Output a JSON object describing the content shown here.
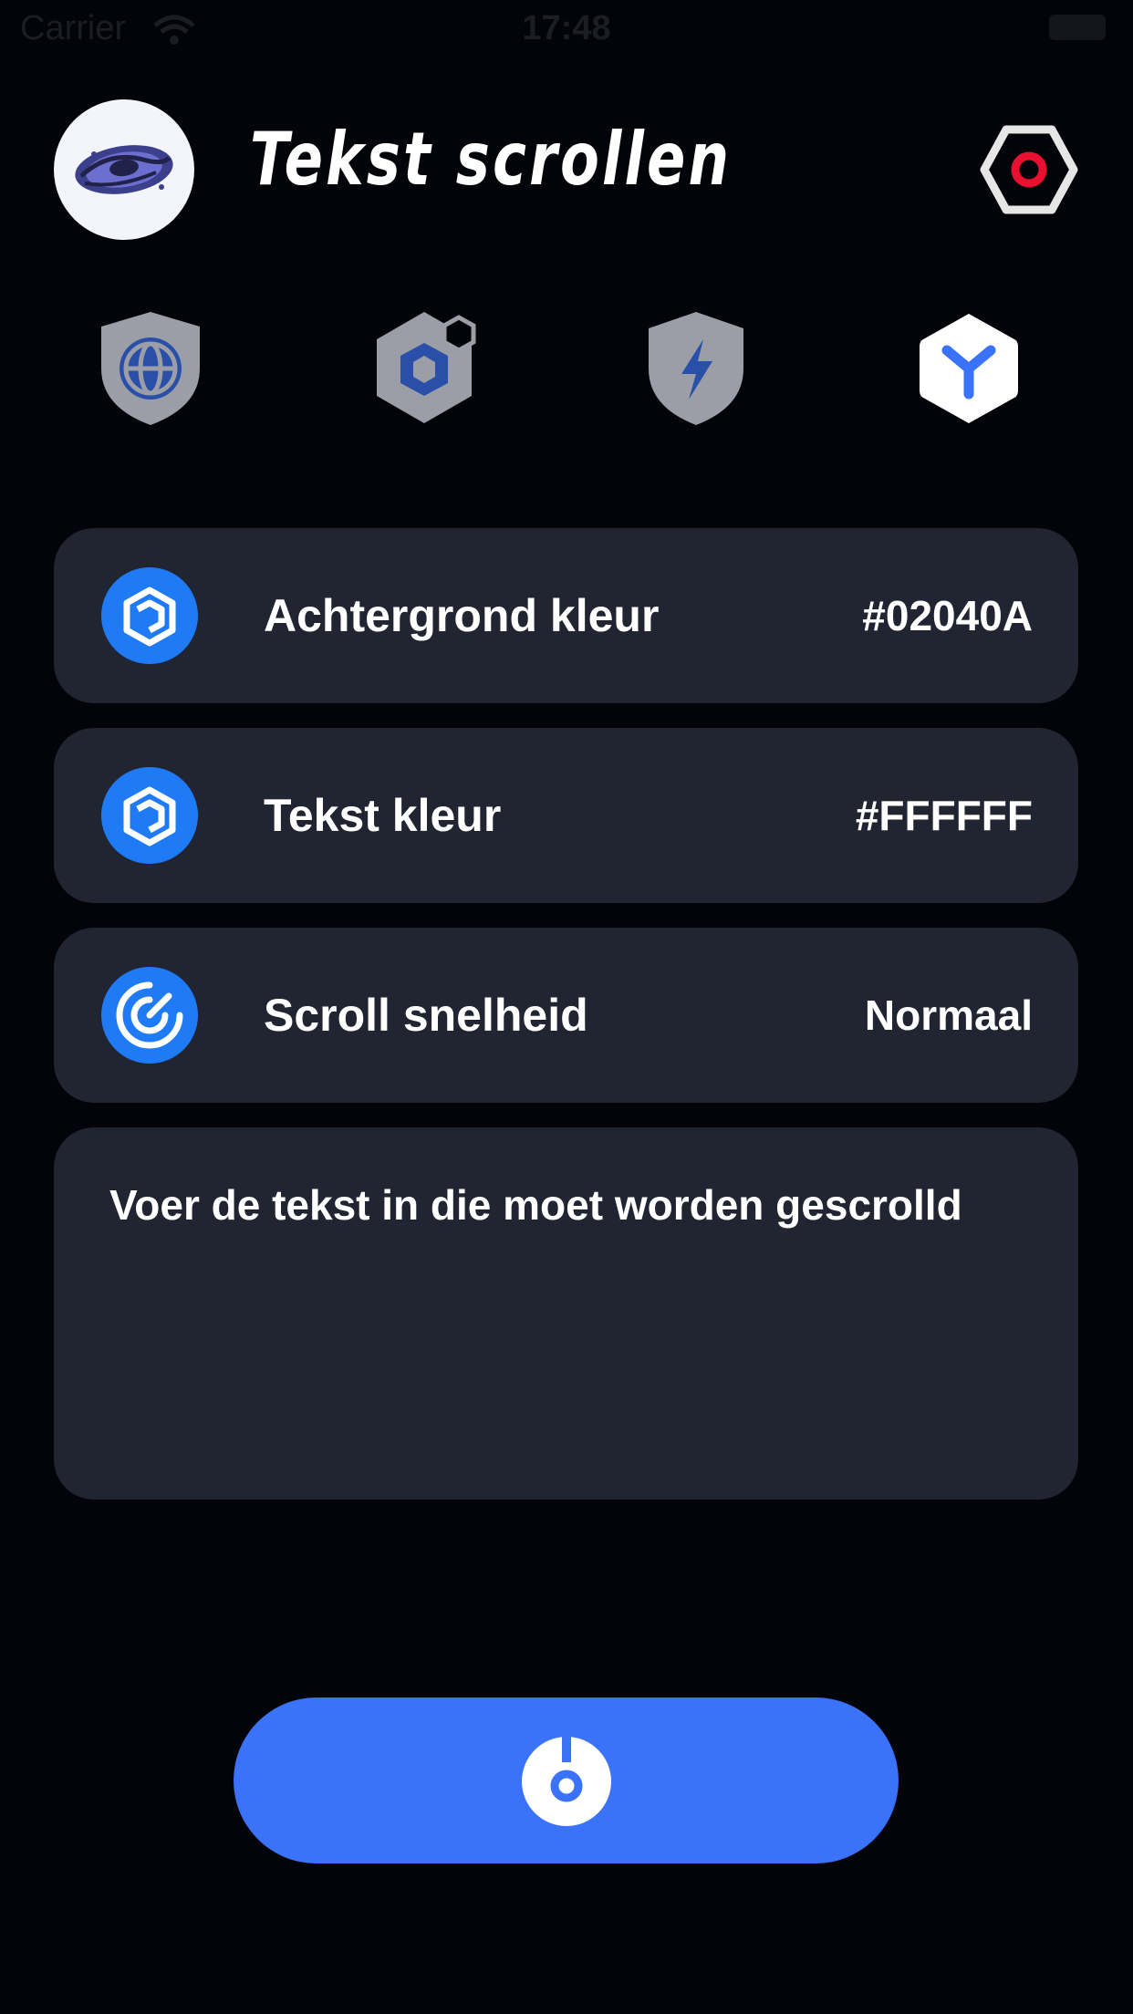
{
  "status_bar": {
    "carrier": "Carrier",
    "time": "17:48",
    "wifi_icon": "wifi-icon",
    "battery_icon": "battery-icon"
  },
  "header": {
    "avatar_icon": "galaxy-logo-icon",
    "title": "Tekst scrollen",
    "settings_icon": "hexagon-record-icon",
    "settings_accent": "#E8102E"
  },
  "tabs": [
    {
      "icon": "globe-shield-icon",
      "selected": false
    },
    {
      "icon": "hexagon-cube-icon",
      "selected": false
    },
    {
      "icon": "lightning-shield-icon",
      "selected": false
    },
    {
      "icon": "hexagon-y-icon",
      "selected": true
    }
  ],
  "settings": [
    {
      "icon": "cube-icon",
      "label": "Achtergrond kleur",
      "value": "#02040A"
    },
    {
      "icon": "cube-icon",
      "label": "Tekst kleur",
      "value": "#FFFFFF"
    },
    {
      "icon": "speed-dial-icon",
      "label": "Scroll snelheid",
      "value": "Normaal"
    }
  ],
  "text_input": {
    "placeholder": "Voer de tekst in die moet worden gescrolld"
  },
  "start_button": {
    "icon": "power-icon"
  },
  "colors": {
    "background": "#02040A",
    "card": "#212431",
    "accent": "#3A72FA",
    "icon_blue": "#1E7BF5",
    "inactive_tab": "#9B9EA6",
    "text": "#FFFFFF"
  }
}
